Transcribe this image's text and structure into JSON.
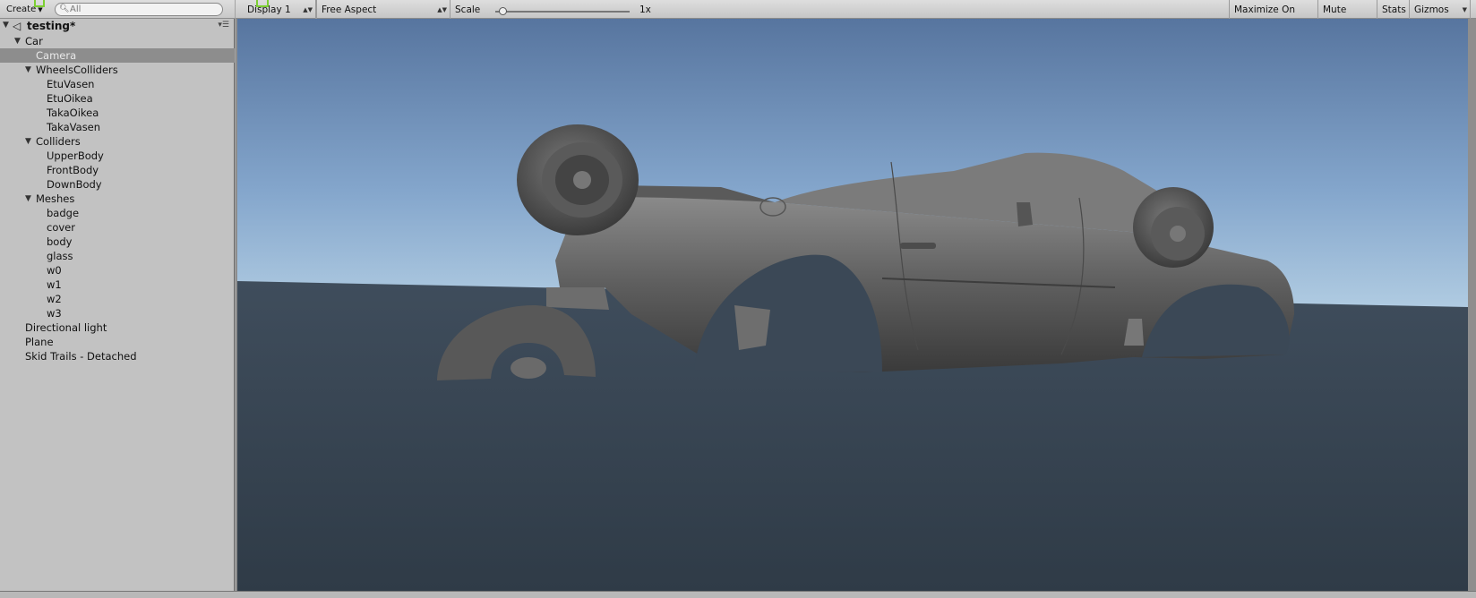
{
  "hierarchy": {
    "create_label": "Create",
    "search_placeholder": "All",
    "scene_name": "testing*",
    "items": [
      {
        "label": "Car",
        "depth": 1,
        "expanded": true
      },
      {
        "label": "Camera",
        "depth": 2,
        "selected": true
      },
      {
        "label": "WheelsColliders",
        "depth": 2,
        "expanded": true
      },
      {
        "label": "EtuVasen",
        "depth": 3
      },
      {
        "label": "EtuOikea",
        "depth": 3
      },
      {
        "label": "TakaOikea",
        "depth": 3
      },
      {
        "label": "TakaVasen",
        "depth": 3
      },
      {
        "label": "Colliders",
        "depth": 2,
        "expanded": true
      },
      {
        "label": "UpperBody",
        "depth": 3
      },
      {
        "label": "FrontBody",
        "depth": 3
      },
      {
        "label": "DownBody",
        "depth": 3
      },
      {
        "label": "Meshes",
        "depth": 2,
        "expanded": true
      },
      {
        "label": "badge",
        "depth": 3
      },
      {
        "label": "cover",
        "depth": 3
      },
      {
        "label": "body",
        "depth": 3
      },
      {
        "label": "glass",
        "depth": 3
      },
      {
        "label": "w0",
        "depth": 3
      },
      {
        "label": "w1",
        "depth": 3
      },
      {
        "label": "w2",
        "depth": 3
      },
      {
        "label": "w3",
        "depth": 3
      },
      {
        "label": "Directional light",
        "depth": 1
      },
      {
        "label": "Plane",
        "depth": 1
      },
      {
        "label": "Skid Trails - Detached",
        "depth": 1
      }
    ]
  },
  "game_toolbar": {
    "display": "Display 1",
    "aspect": "Free Aspect",
    "scale_label": "Scale",
    "scale_value": "1x",
    "maximize_on_play": "Maximize On Play",
    "mute_audio": "Mute Audio",
    "stats": "Stats",
    "gizmos": "Gizmos"
  },
  "icons": {
    "scene": "unity-icon",
    "search": "search-icon",
    "fold": "triangle-down-icon",
    "menu": "menu-icon"
  },
  "colors": {
    "sky_top": "#5b7aa6",
    "sky_horizon": "#b5cfe3",
    "ground": "#334150",
    "selection": "#8d8d8d"
  }
}
